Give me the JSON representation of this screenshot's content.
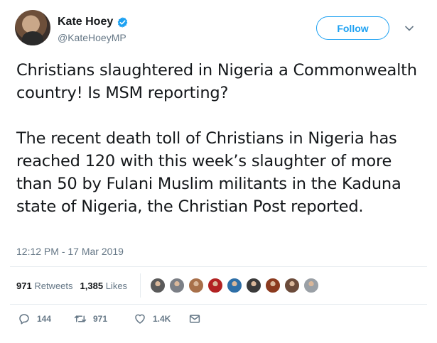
{
  "user": {
    "display_name": "Kate Hoey",
    "handle": "@KateHoeyMP",
    "verified": true,
    "follow_label": "Follow"
  },
  "tweet": {
    "paragraphs": [
      "Christians slaughtered in Nigeria a Commonwealth country! Is MSM reporting?",
      "The recent death toll of Christians in Nigeria has reached 120 with this week’s slaughter of more than 50 by Fulani Muslim militants in the Kaduna state of Nigeria, the Christian Post reported."
    ],
    "timestamp": "12:12 PM - 17 Mar 2019"
  },
  "stats": {
    "retweets_count": "971",
    "retweets_label": "Retweets",
    "likes_count": "1,385",
    "likes_label": "Likes"
  },
  "actions": {
    "reply_count": "144",
    "retweet_count": "971",
    "like_count": "1.4K"
  },
  "colors": {
    "accent": "#1da1f2",
    "muted": "#657786",
    "text": "#14171a",
    "border": "#e6ecf0"
  },
  "likers": [
    {
      "name": "liker-avatar-1",
      "color": "#5a5a5a"
    },
    {
      "name": "liker-avatar-2",
      "color": "#7b7f86"
    },
    {
      "name": "liker-avatar-3",
      "color": "#a8704a"
    },
    {
      "name": "liker-avatar-4",
      "color": "#b22222"
    },
    {
      "name": "liker-avatar-5",
      "color": "#2e6fa7"
    },
    {
      "name": "liker-avatar-6",
      "color": "#3a3a3a"
    },
    {
      "name": "liker-avatar-7",
      "color": "#8b3a1e"
    },
    {
      "name": "liker-avatar-8",
      "color": "#6b4b3a"
    },
    {
      "name": "liker-avatar-9",
      "color": "#9aa0a6"
    }
  ]
}
